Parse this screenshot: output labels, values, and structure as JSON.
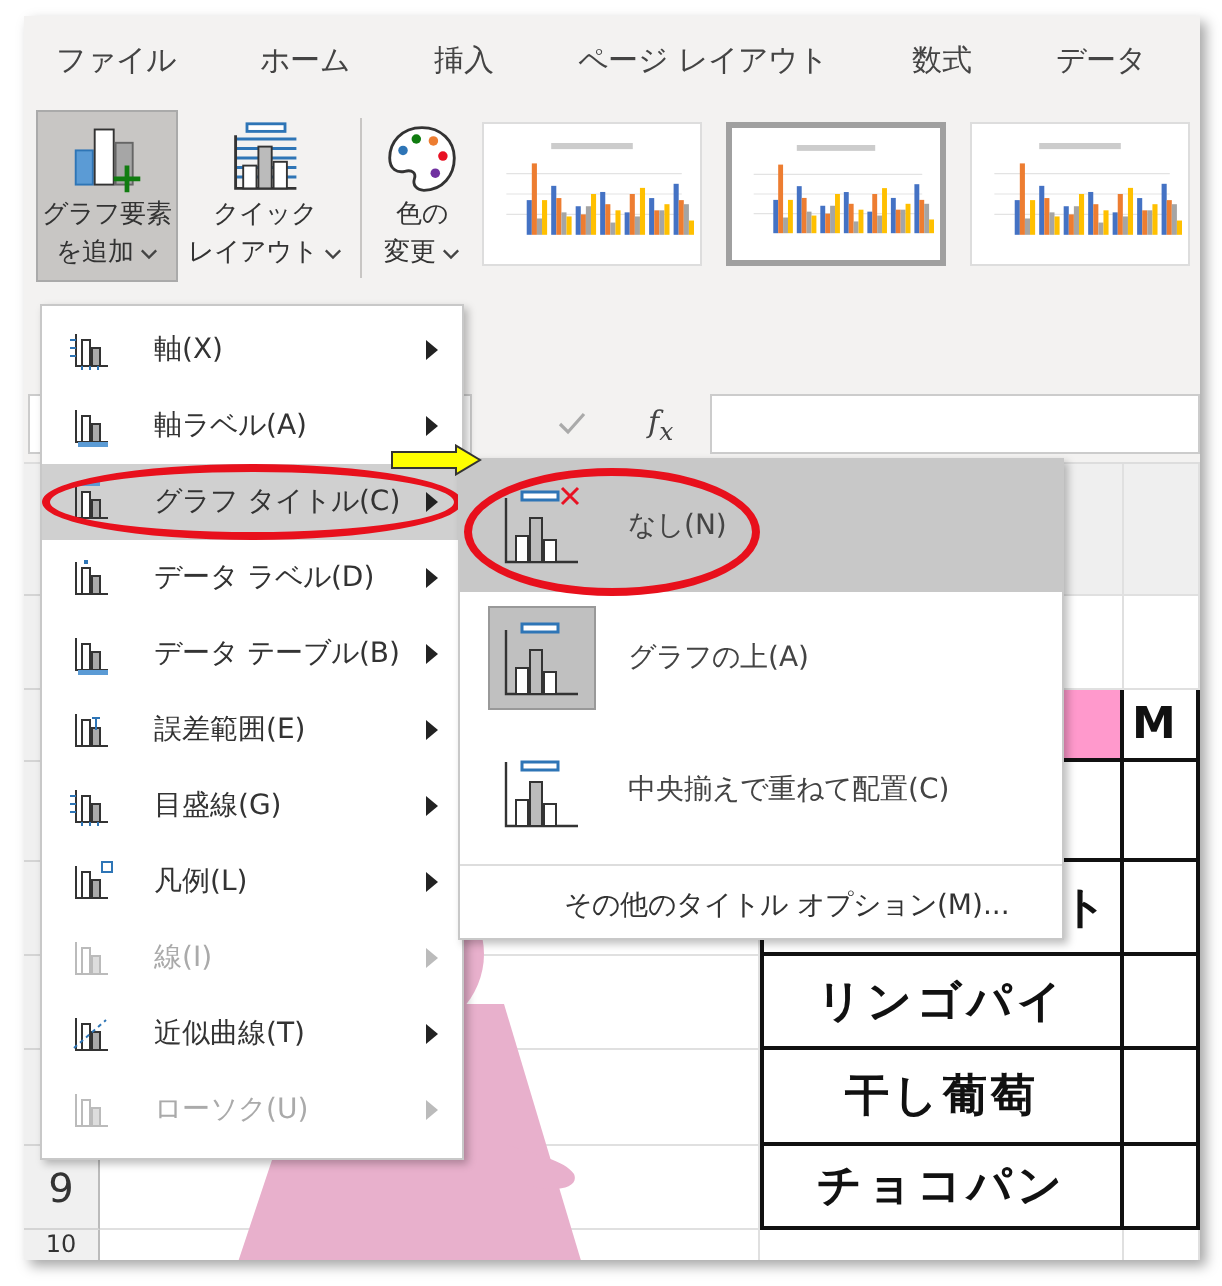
{
  "tabs": [
    "ファイル",
    "ホーム",
    "挿入",
    "ページ レイアウト",
    "数式",
    "データ"
  ],
  "ribbon": {
    "buttons": [
      {
        "lines": [
          "グラフ要素",
          "を追加"
        ],
        "selected": true
      },
      {
        "lines": [
          "クイック",
          "レイアウト"
        ],
        "selected": false
      },
      {
        "lines": [
          "色の",
          "変更"
        ],
        "selected": false
      }
    ],
    "styles": [
      {
        "selected": false
      },
      {
        "selected": true
      },
      {
        "selected": false
      }
    ]
  },
  "formula_bar": {
    "function_label": "f$_{x}$"
  },
  "sheet": {
    "row_numbers": [
      "9",
      "10"
    ],
    "header_cells": [
      "M"
    ],
    "rows": [
      {
        "name": "ト",
        "clipped_start": true
      },
      {
        "name": "リンゴパイ",
        "clipped_start": false
      },
      {
        "name": "干し葡萄",
        "clipped_start": false
      },
      {
        "name": "チョコパン",
        "clipped_start": false
      }
    ]
  },
  "menu": {
    "arrow_to_submenu": true,
    "items": [
      {
        "label": "軸(X)",
        "selected": false,
        "disabled": false,
        "circled": false
      },
      {
        "label": "軸ラベル(A)",
        "selected": false,
        "disabled": false,
        "circled": false
      },
      {
        "label": "グラフ タイトル(C)",
        "selected": true,
        "disabled": false,
        "circled": true
      },
      {
        "label": "データ ラベル(D)",
        "selected": false,
        "disabled": false,
        "circled": false
      },
      {
        "label": "データ テーブル(B)",
        "selected": false,
        "disabled": false,
        "circled": false
      },
      {
        "label": "誤差範囲(E)",
        "selected": false,
        "disabled": false,
        "circled": false
      },
      {
        "label": "目盛線(G)",
        "selected": false,
        "disabled": false,
        "circled": false
      },
      {
        "label": "凡例(L)",
        "selected": false,
        "disabled": false,
        "circled": false
      },
      {
        "label": "線(I)",
        "selected": false,
        "disabled": true,
        "circled": false
      },
      {
        "label": "近似曲線(T)",
        "selected": false,
        "disabled": false,
        "circled": false
      },
      {
        "label": "ローソク(U)",
        "selected": false,
        "disabled": true,
        "circled": false
      }
    ]
  },
  "submenu": {
    "items": [
      {
        "label": "なし(N)",
        "selected": true,
        "current": false,
        "circled": true
      },
      {
        "label": "グラフの上(A)",
        "selected": false,
        "current": true,
        "circled": false
      },
      {
        "label": "中央揃えで重ねて配置(C)",
        "selected": false,
        "current": false,
        "circled": false
      }
    ],
    "footer": "その他のタイトル オプション(M)..."
  }
}
